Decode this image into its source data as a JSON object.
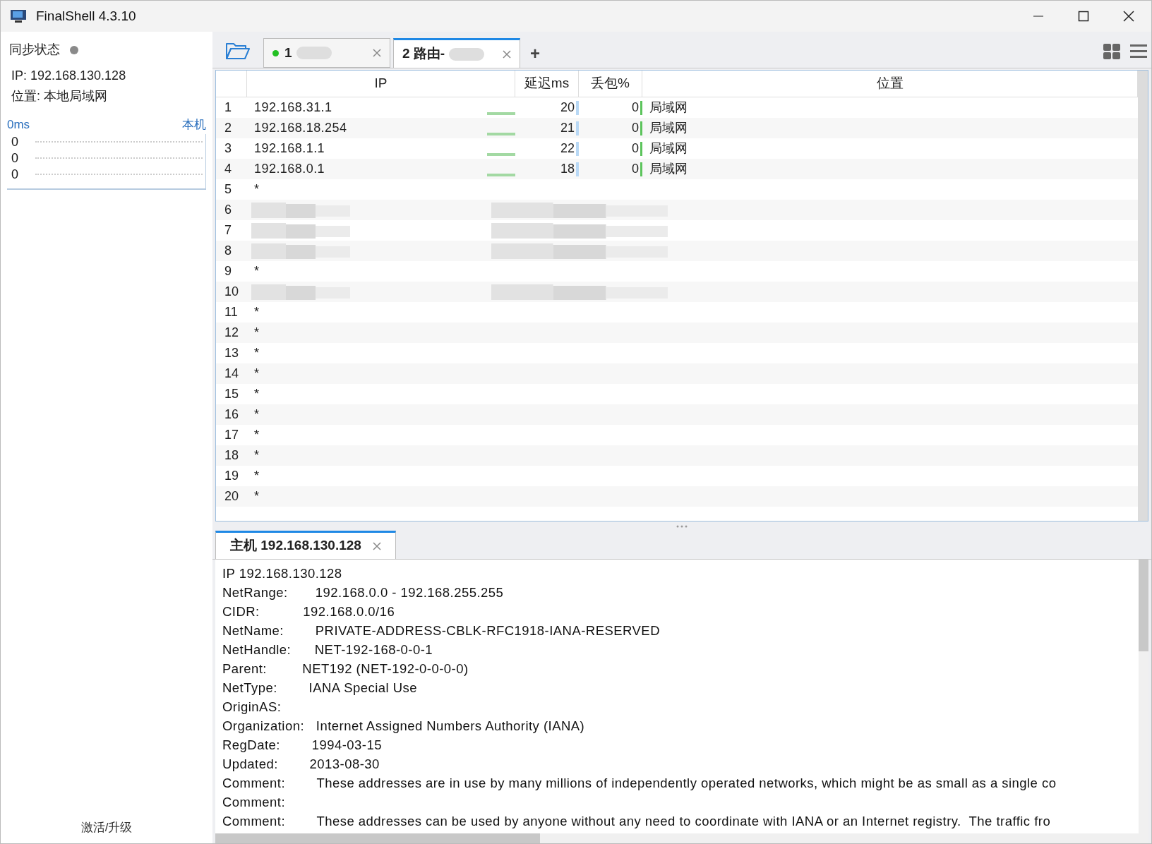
{
  "window": {
    "title": "FinalShell 4.3.10"
  },
  "sidebar": {
    "sync_label": "同步状态",
    "ip": "IP: 192.168.130.128",
    "location": "位置: 本地局域网",
    "chart_unit": "0ms",
    "chart_host": "本机",
    "chart_values": [
      "0",
      "0",
      "0"
    ],
    "footer": "激活/升级"
  },
  "tabs": [
    {
      "label": "1",
      "selected": false,
      "connected": true
    },
    {
      "label": "2 路由-",
      "selected": true,
      "connected": false
    }
  ],
  "new_tab": "+",
  "table": {
    "columns": [
      "IP",
      "延迟ms",
      "丢包%",
      "位置"
    ],
    "rows": [
      {
        "kind": "hop",
        "num": "1",
        "ip": "192.168.31.1",
        "latency": "20",
        "loss": "0",
        "location": "局域网"
      },
      {
        "kind": "hop",
        "num": "2",
        "ip": "192.168.18.254",
        "latency": "21",
        "loss": "0",
        "location": "局域网"
      },
      {
        "kind": "hop",
        "num": "3",
        "ip": "192.168.1.1",
        "latency": "22",
        "loss": "0",
        "location": "局域网"
      },
      {
        "kind": "hop",
        "num": "4",
        "ip": "192.168.0.1",
        "latency": "18",
        "loss": "0",
        "location": "局域网"
      },
      {
        "kind": "timeout",
        "num": "5",
        "ip": "*"
      },
      {
        "kind": "redacted",
        "num": "6"
      },
      {
        "kind": "redacted",
        "num": "7"
      },
      {
        "kind": "redacted",
        "num": "8"
      },
      {
        "kind": "timeout",
        "num": "9",
        "ip": "*"
      },
      {
        "kind": "redacted",
        "num": "10"
      },
      {
        "kind": "timeout",
        "num": "11",
        "ip": "*"
      },
      {
        "kind": "timeout",
        "num": "12",
        "ip": "*"
      },
      {
        "kind": "timeout",
        "num": "13",
        "ip": "*"
      },
      {
        "kind": "timeout",
        "num": "14",
        "ip": "*"
      },
      {
        "kind": "timeout",
        "num": "15",
        "ip": "*"
      },
      {
        "kind": "timeout",
        "num": "16",
        "ip": "*"
      },
      {
        "kind": "timeout",
        "num": "17",
        "ip": "*"
      },
      {
        "kind": "timeout",
        "num": "18",
        "ip": "*"
      },
      {
        "kind": "timeout",
        "num": "19",
        "ip": "*"
      },
      {
        "kind": "timeout",
        "num": "20",
        "ip": "*"
      }
    ]
  },
  "detail": {
    "tab": {
      "label": "主机 192.168.130.128",
      "selected": true
    },
    "lines": [
      "IP 192.168.130.128",
      "NetRange:       192.168.0.0 - 192.168.255.255",
      "CIDR:           192.168.0.0/16",
      "NetName:        PRIVATE-ADDRESS-CBLK-RFC1918-IANA-RESERVED",
      "NetHandle:      NET-192-168-0-0-1",
      "Parent:         NET192 (NET-192-0-0-0-0)",
      "NetType:        IANA Special Use",
      "OriginAS:",
      "Organization:   Internet Assigned Numbers Authority (IANA)",
      "RegDate:        1994-03-15",
      "Updated:        2013-08-30",
      "Comment:        These addresses are in use by many millions of independently operated networks, which might be as small as a single co",
      "Comment:",
      "Comment:        These addresses can be used by anyone without any need to coordinate with IANA or an Internet registry.  The traffic fro"
    ]
  }
}
